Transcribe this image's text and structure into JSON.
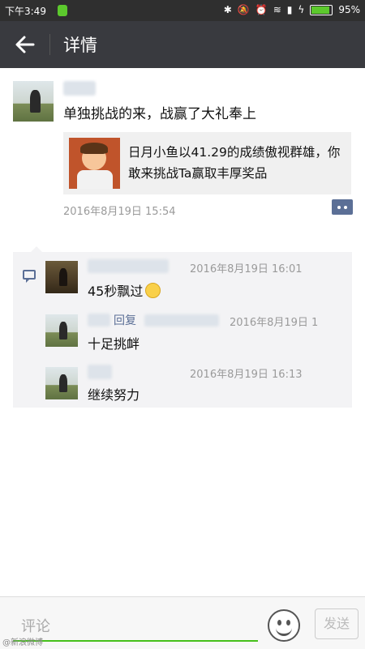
{
  "status_bar": {
    "time": "下午3:49",
    "battery": "95%",
    "icons": [
      "bluetooth-icon",
      "mute-icon",
      "alarm-icon",
      "wifi-icon",
      "signal-icon",
      "charging-icon",
      "battery-icon"
    ]
  },
  "header": {
    "back_icon": "arrow-left-icon",
    "title": "详情"
  },
  "post": {
    "text": "单独挑战的来，战赢了大礼奉上",
    "share": {
      "text": "日月小鱼以41.29的成绩傲视群雄，你敢来挑战Ta赢取丰厚奖品"
    },
    "timestamp": "2016年8月19日 15:54"
  },
  "comments": [
    {
      "time": "2016年8月19日 16:01",
      "text": "45秒飘过"
    },
    {
      "reply_label": "回复",
      "time": "2016年8月19日 1",
      "text": "十足挑衅"
    },
    {
      "time": "2016年8月19日 16:13",
      "text": "继续努力"
    }
  ],
  "input_bar": {
    "placeholder": "评论",
    "send_label": "发送",
    "emoji_icon": "smiley-icon"
  },
  "watermark": "@新浪微博"
}
